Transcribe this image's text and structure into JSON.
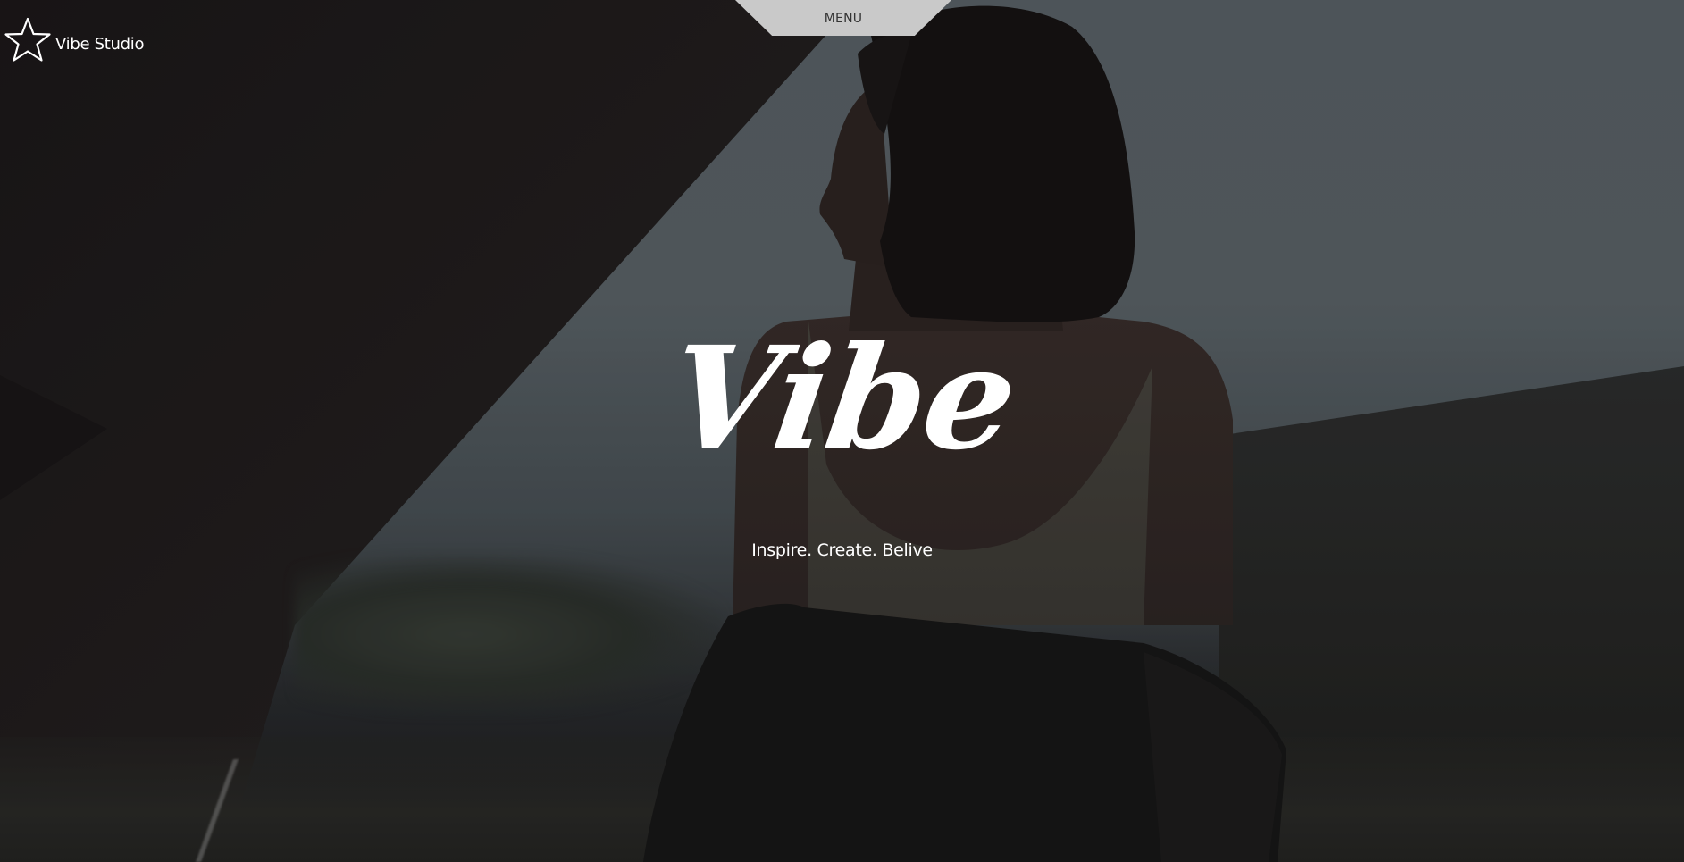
{
  "brand": {
    "name": "Vibe Studio",
    "logo_icon": "star-outline-icon"
  },
  "nav": {
    "menu_label": "MENU"
  },
  "hero": {
    "title": "Vibe",
    "tagline": "Inspire. Create. Belive"
  },
  "colors": {
    "menu_tab": "#c9c9c9",
    "text": "#ffffff",
    "menu_text": "#333333"
  }
}
